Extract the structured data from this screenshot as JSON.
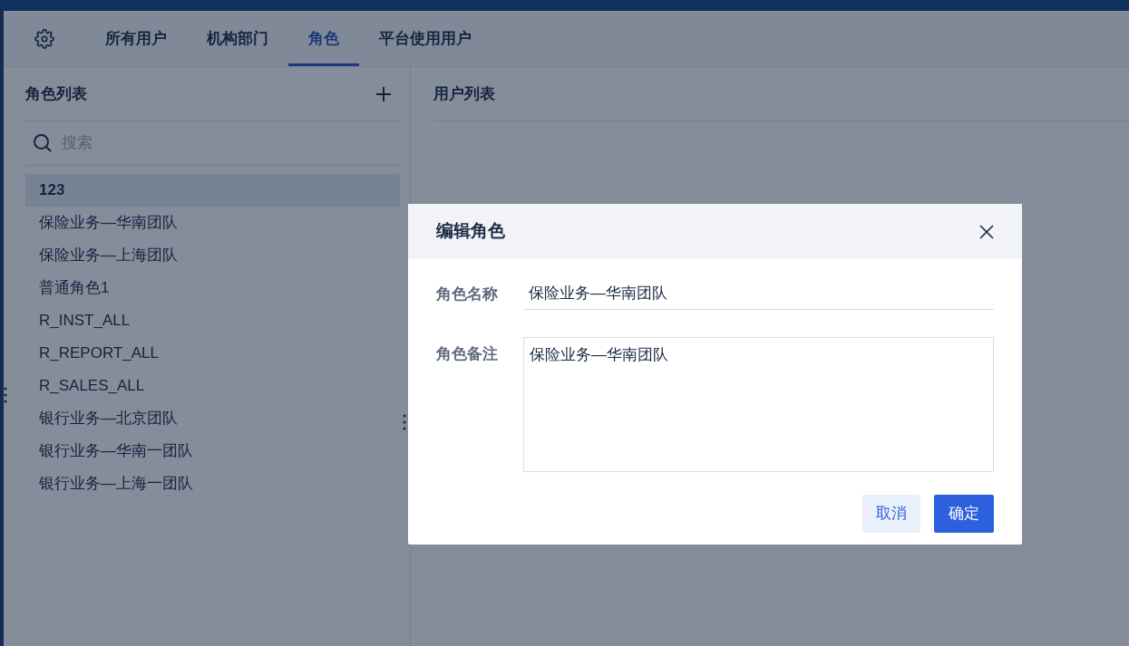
{
  "tabs": [
    {
      "label": "所有用户",
      "selected": false
    },
    {
      "label": "机构部门",
      "selected": false
    },
    {
      "label": "角色",
      "selected": true
    },
    {
      "label": "平台使用用户",
      "selected": false
    }
  ],
  "role_panel": {
    "title": "角色列表",
    "search": {
      "placeholder": "搜索"
    },
    "items": [
      {
        "label": "123",
        "selected": true
      },
      {
        "label": "保险业务—华南团队",
        "selected": false
      },
      {
        "label": "保险业务—上海团队",
        "selected": false
      },
      {
        "label": "普通角色1",
        "selected": false
      },
      {
        "label": "R_INST_ALL",
        "selected": false
      },
      {
        "label": "R_REPORT_ALL",
        "selected": false
      },
      {
        "label": "R_SALES_ALL",
        "selected": false
      },
      {
        "label": "银行业务—北京团队",
        "selected": false
      },
      {
        "label": "银行业务—华南一团队",
        "selected": false
      },
      {
        "label": "银行业务—上海一团队",
        "selected": false
      }
    ]
  },
  "user_panel": {
    "title": "用户列表"
  },
  "dialog": {
    "title": "编辑角色",
    "fields": [
      {
        "label": "角色名称",
        "kind": "input",
        "value": "保险业务—华南团队"
      },
      {
        "label": "角色备注",
        "kind": "textarea",
        "value": "保险业务—华南团队"
      }
    ],
    "buttons": [
      {
        "label": "取消",
        "kind": "secondary"
      },
      {
        "label": "确定",
        "kind": "primary"
      }
    ]
  }
}
